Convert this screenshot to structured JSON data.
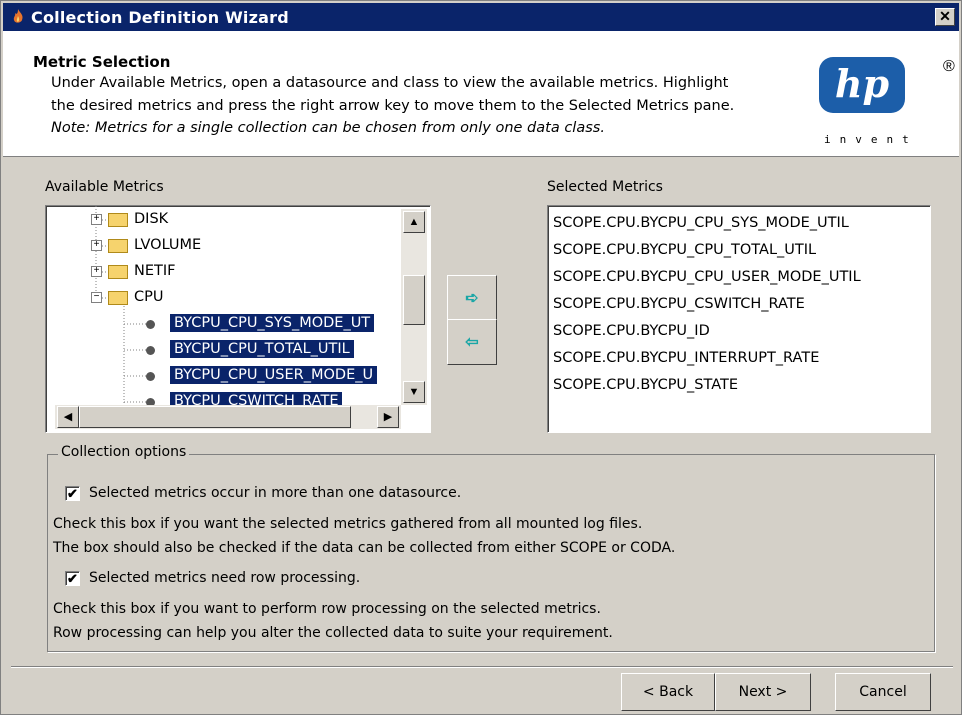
{
  "window": {
    "title": "Collection Definition Wizard",
    "close_glyph": "✕"
  },
  "header": {
    "title": "Metric Selection",
    "line1": "Under Available Metrics, open a datasource and class to view the available metrics. Highlight",
    "line2": "the desired metrics and press the right arrow key to move them to the Selected Metrics pane.",
    "note": "Note: Metrics for a single collection can be chosen from only one data class.",
    "logo_text": "hp",
    "logo_registered": "®",
    "logo_tagline": "invent"
  },
  "available": {
    "label": "Available Metrics",
    "folders": [
      {
        "label": "DISK",
        "expander": "+"
      },
      {
        "label": "LVOLUME",
        "expander": "+"
      },
      {
        "label": "NETIF",
        "expander": "+"
      },
      {
        "label": "CPU",
        "expander": "−"
      }
    ],
    "metrics": [
      "BYCPU_CPU_SYS_MODE_UT",
      "BYCPU_CPU_TOTAL_UTIL",
      "BYCPU_CPU_USER_MODE_U",
      "BYCPU_CSWITCH_RATE"
    ]
  },
  "arrows": {
    "right": "➪",
    "left": "⇦"
  },
  "selected": {
    "label": "Selected Metrics",
    "items": [
      "SCOPE.CPU.BYCPU_CPU_SYS_MODE_UTIL",
      "SCOPE.CPU.BYCPU_CPU_TOTAL_UTIL",
      "SCOPE.CPU.BYCPU_CPU_USER_MODE_UTIL",
      "SCOPE.CPU.BYCPU_CSWITCH_RATE",
      "SCOPE.CPU.BYCPU_ID",
      "SCOPE.CPU.BYCPU_INTERRUPT_RATE",
      "SCOPE.CPU.BYCPU_STATE"
    ]
  },
  "options": {
    "title": "Collection options",
    "opt1": {
      "label": "Selected metrics occur in more than one datasource.",
      "checked": true,
      "check_glyph": "✔",
      "help1": "Check this box if you want the selected metrics gathered from all mounted log files.",
      "help2": "The box should also be checked if the data can be collected from either SCOPE or CODA."
    },
    "opt2": {
      "label": "Selected metrics need row processing.",
      "checked": true,
      "check_glyph": "✔",
      "help1": "Check this box if you want to perform row processing on the selected metrics.",
      "help2": "Row processing can help you alter the collected data to suite your requirement."
    }
  },
  "buttons": {
    "back": "< Back",
    "next": "Next >",
    "cancel": "Cancel"
  },
  "scroll": {
    "up": "▲",
    "down": "▼",
    "left": "◀",
    "right": "▶"
  }
}
